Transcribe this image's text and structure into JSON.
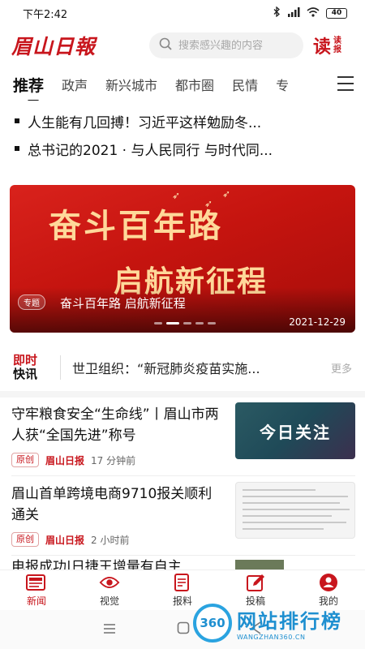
{
  "status_bar": {
    "time": "下午2:42",
    "battery": "40"
  },
  "header": {
    "logo": "眉山日報",
    "search_placeholder": "搜索感兴趣的内容",
    "read_big": "读",
    "read_small": "读报"
  },
  "tabs": [
    "推荐",
    "政声",
    "新兴城市",
    "都市圈",
    "民情",
    "专"
  ],
  "headlines": [
    "人生能有几回搏！习近平这样勉励冬...",
    "总书记的2021 · 与人民同行 与时代同..."
  ],
  "banner": {
    "title1": "奋斗百年路",
    "title2": "启航新征程",
    "tag": "专题",
    "caption": "奋斗百年路 启航新征程",
    "date": "2021-12-29"
  },
  "flash": {
    "logo_line1": "即时",
    "logo_line2": "快讯",
    "text": "世卫组织：“新冠肺炎疫苗实施...",
    "more": "更多"
  },
  "news": [
    {
      "title": "守牢粮食安全“生命线”丨眉山市两人获“全国先进”称号",
      "tag": "原创",
      "source": "眉山日报",
      "time": "17 分钟前",
      "thumb_text": "今日关注"
    },
    {
      "title": "眉山首单跨境电商9710报关顺利通关",
      "tag": "原创",
      "source": "眉山日报",
      "time": "2 小时前"
    }
  ],
  "partial_title": "电报成功|日捷王增量有自主",
  "bottom_nav": [
    {
      "label": "新闻",
      "icon": "news-icon",
      "active": true
    },
    {
      "label": "视觉",
      "icon": "eye-icon",
      "active": false
    },
    {
      "label": "报料",
      "icon": "report-icon",
      "active": false
    },
    {
      "label": "投稿",
      "icon": "edit-icon",
      "active": false
    },
    {
      "label": "我的",
      "icon": "profile-icon",
      "active": false
    }
  ],
  "watermark": {
    "badge": "360",
    "big": "网站排行榜",
    "small": "WANGZHAN360.CN"
  },
  "colors": {
    "brand_red": "#c8161d",
    "watermark_blue": "#1e8fd0"
  }
}
